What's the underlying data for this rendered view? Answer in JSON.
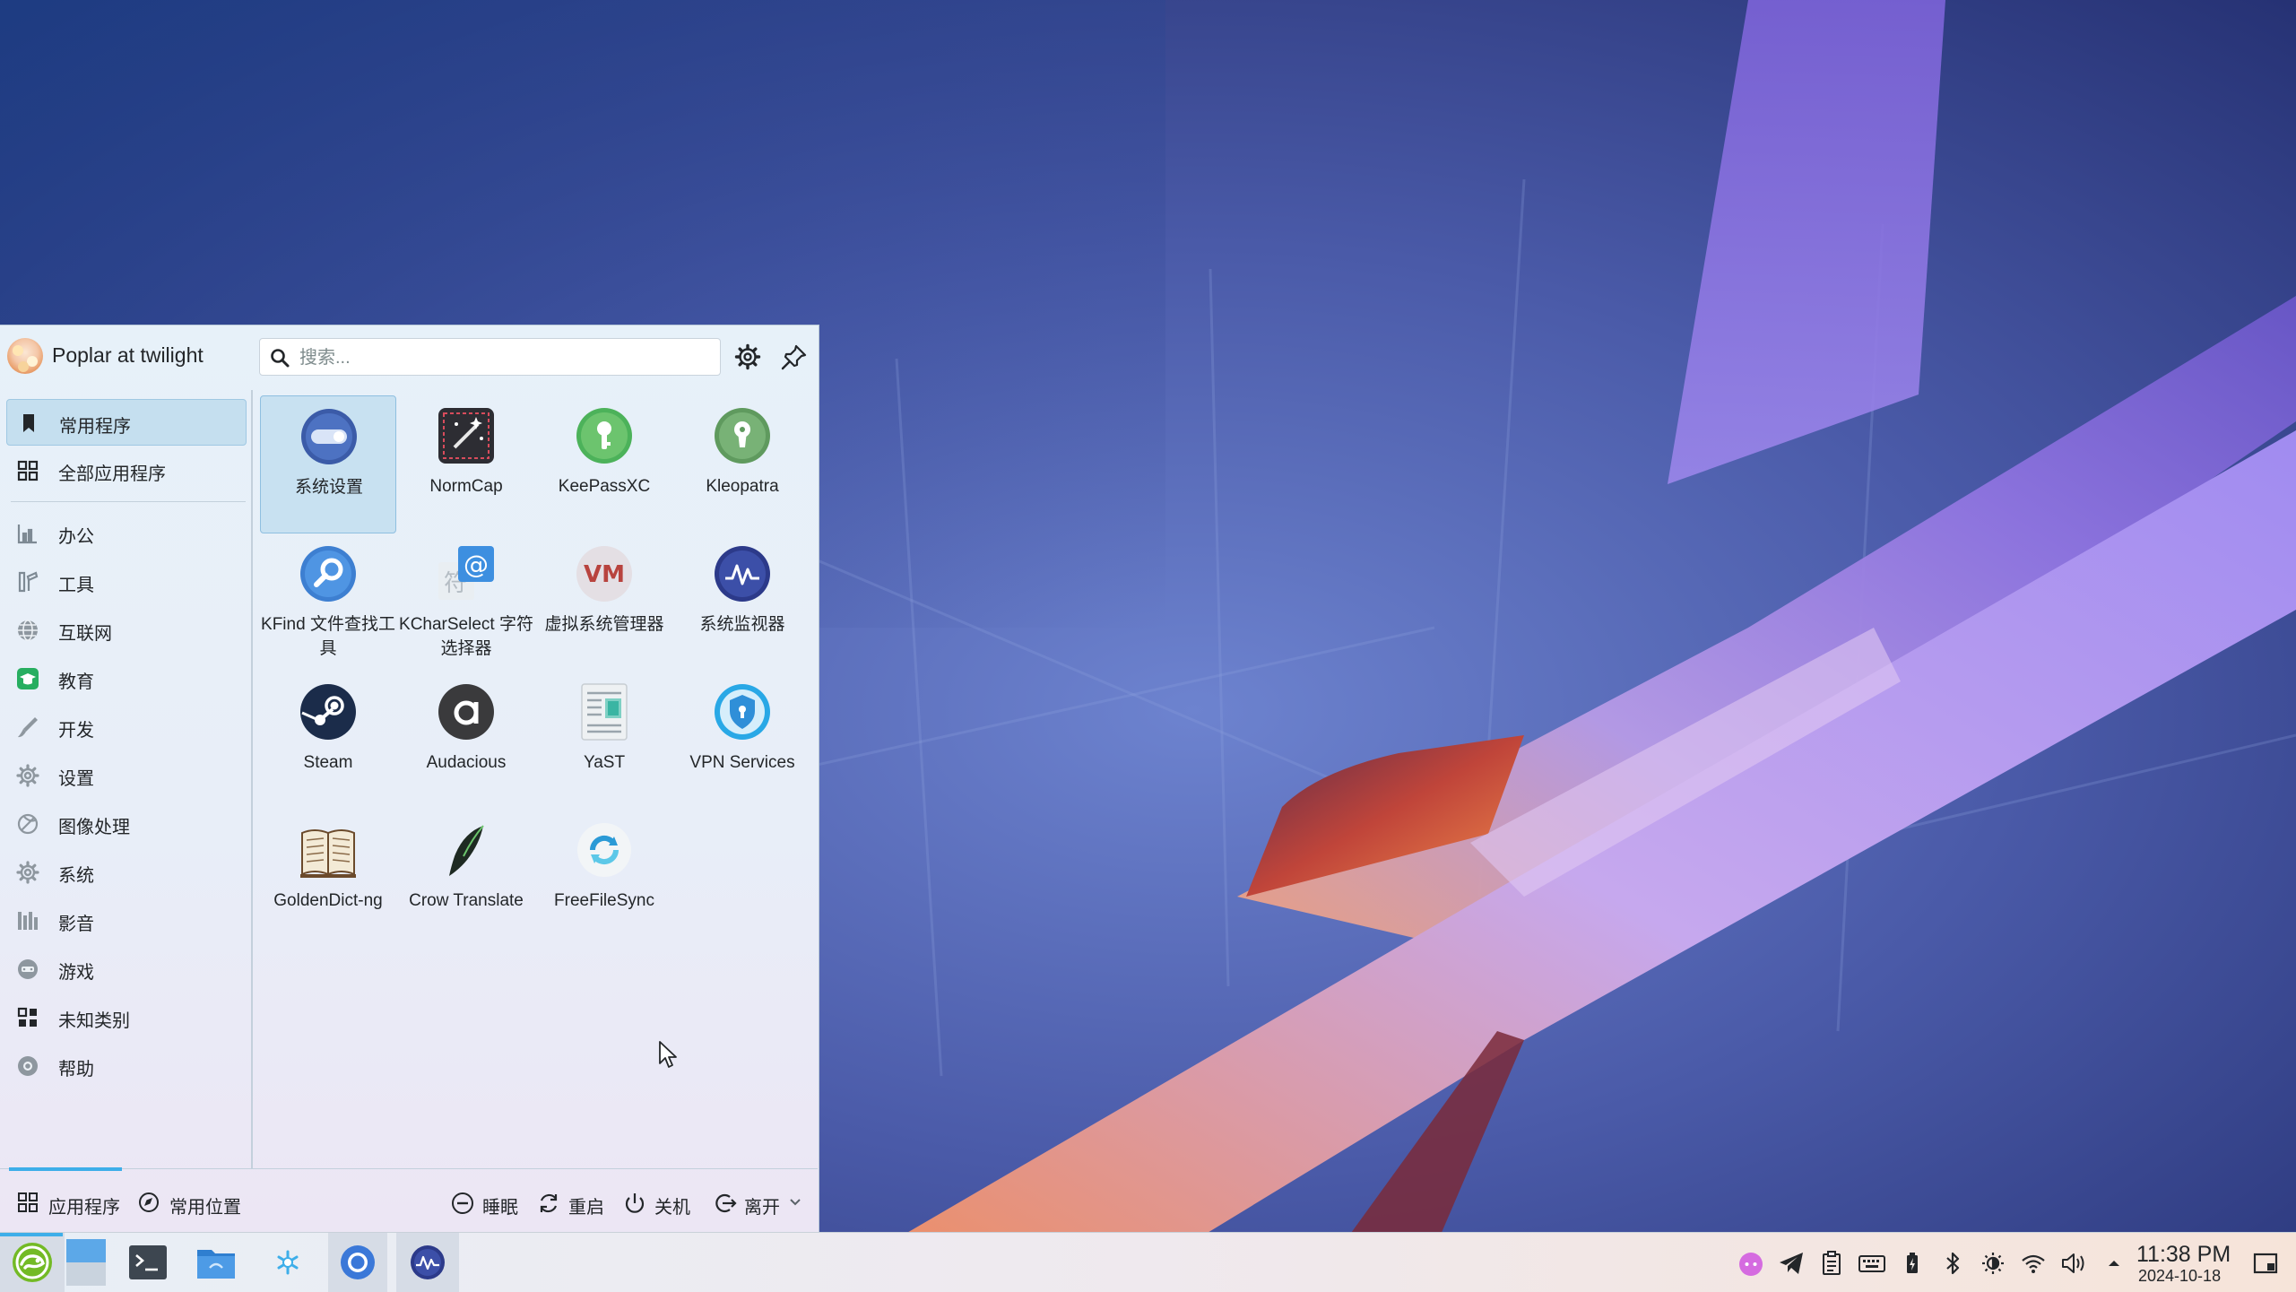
{
  "user": {
    "name": "Poplar at twilight"
  },
  "search": {
    "placeholder": "搜索..."
  },
  "header_buttons": {
    "settings_icon": "gear-icon",
    "pin_icon": "pin-icon"
  },
  "sidebar": {
    "items": [
      {
        "label": "常用程序",
        "icon": "bookmark-icon",
        "selected": true
      },
      {
        "label": "全部应用程序",
        "icon": "grid-icon"
      },
      {
        "label": "办公",
        "icon": "office-icon"
      },
      {
        "label": "工具",
        "icon": "tools-icon"
      },
      {
        "label": "互联网",
        "icon": "globe-icon"
      },
      {
        "label": "教育",
        "icon": "education-icon"
      },
      {
        "label": "开发",
        "icon": "development-icon"
      },
      {
        "label": "设置",
        "icon": "settings-icon"
      },
      {
        "label": "图像处理",
        "icon": "graphics-icon"
      },
      {
        "label": "系统",
        "icon": "system-icon"
      },
      {
        "label": "影音",
        "icon": "multimedia-icon"
      },
      {
        "label": "游戏",
        "icon": "games-icon"
      },
      {
        "label": "未知类别",
        "icon": "unknown-icon"
      },
      {
        "label": "帮助",
        "icon": "help-icon"
      }
    ]
  },
  "apps": [
    {
      "label": "系统设置",
      "icon": "system-settings-icon",
      "selected": true
    },
    {
      "label": "NormCap",
      "icon": "normcap-icon"
    },
    {
      "label": "KeePassXC",
      "icon": "keepassxc-icon"
    },
    {
      "label": "Kleopatra",
      "icon": "kleopatra-icon"
    },
    {
      "label": "KFind 文件查找工具",
      "icon": "kfind-icon"
    },
    {
      "label": "KCharSelect 字符选择器",
      "icon": "kcharselect-icon"
    },
    {
      "label": "虚拟系统管理器",
      "icon": "virt-manager-icon"
    },
    {
      "label": "系统监视器",
      "icon": "system-monitor-icon"
    },
    {
      "label": "Steam",
      "icon": "steam-icon"
    },
    {
      "label": "Audacious",
      "icon": "audacious-icon"
    },
    {
      "label": "YaST",
      "icon": "yast-icon"
    },
    {
      "label": "VPN Services",
      "icon": "vpn-icon"
    },
    {
      "label": "GoldenDict-ng",
      "icon": "goldendict-icon"
    },
    {
      "label": "Crow Translate",
      "icon": "crow-translate-icon"
    },
    {
      "label": "FreeFileSync",
      "icon": "freefilesync-icon"
    }
  ],
  "footer": {
    "tabs": [
      {
        "label": "应用程序",
        "icon": "applications-icon",
        "active": true
      },
      {
        "label": "常用位置",
        "icon": "places-icon"
      }
    ],
    "power": [
      {
        "label": "睡眠",
        "icon": "sleep-icon"
      },
      {
        "label": "重启",
        "icon": "restart-icon"
      },
      {
        "label": "关机",
        "icon": "shutdown-icon"
      },
      {
        "label": "离开",
        "icon": "leave-icon"
      }
    ]
  },
  "taskbar": {
    "items": [
      {
        "name": "application-launcher",
        "icon": "opensuse-icon",
        "active": true
      },
      {
        "name": "show-desktop",
        "icon": "desktop-pager-icon"
      },
      {
        "name": "konsole",
        "icon": "terminal-icon"
      },
      {
        "name": "dolphin",
        "icon": "file-manager-icon"
      },
      {
        "name": "discover",
        "icon": "discover-icon"
      },
      {
        "name": "browser",
        "icon": "chromium-icon"
      },
      {
        "name": "system-monitor",
        "icon": "system-monitor-icon",
        "active": true
      }
    ],
    "tray": [
      "cat-icon",
      "telegram-icon",
      "clipboard-icon",
      "keyboard-icon",
      "battery-icon",
      "bluetooth-icon",
      "brightness-icon",
      "wifi-icon",
      "volume-icon",
      "expand-tray-icon"
    ],
    "clock": {
      "time": "11:38 PM",
      "date": "2024-10-18"
    }
  }
}
